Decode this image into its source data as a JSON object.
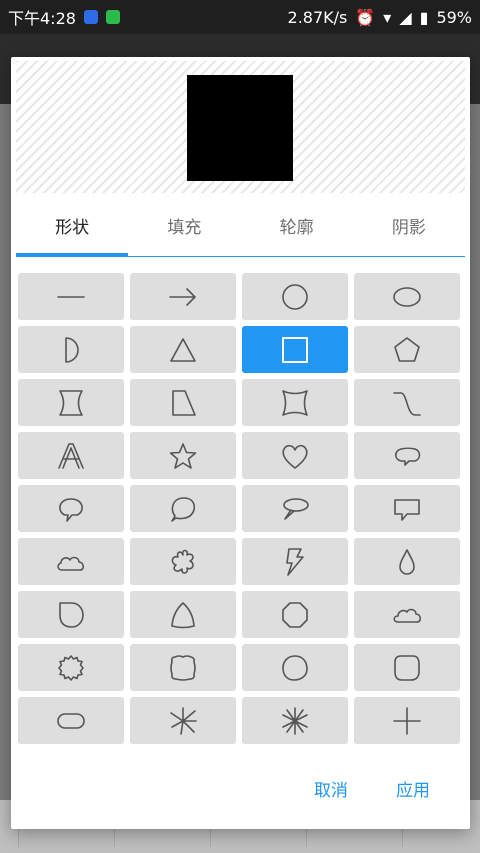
{
  "status_bar": {
    "time": "下午4:28",
    "speed": "2.87K/s",
    "battery": "59%"
  },
  "tabs": [
    {
      "label": "形状",
      "active": true
    },
    {
      "label": "填充",
      "active": false
    },
    {
      "label": "轮廓",
      "active": false
    },
    {
      "label": "阴影",
      "active": false
    }
  ],
  "shapes": [
    {
      "name": "line",
      "selected": false
    },
    {
      "name": "arrow",
      "selected": false
    },
    {
      "name": "circle",
      "selected": false
    },
    {
      "name": "ellipse",
      "selected": false
    },
    {
      "name": "half-circle",
      "selected": false
    },
    {
      "name": "triangle",
      "selected": false
    },
    {
      "name": "square",
      "selected": true
    },
    {
      "name": "pentagon",
      "selected": false
    },
    {
      "name": "hourglass",
      "selected": false
    },
    {
      "name": "trapezoid",
      "selected": false
    },
    {
      "name": "concave-square",
      "selected": false
    },
    {
      "name": "s-curve",
      "selected": false
    },
    {
      "name": "letter-a",
      "selected": false
    },
    {
      "name": "star",
      "selected": false
    },
    {
      "name": "heart",
      "selected": false
    },
    {
      "name": "speech-oval",
      "selected": false
    },
    {
      "name": "speech-bubble",
      "selected": false
    },
    {
      "name": "round-bubble",
      "selected": false
    },
    {
      "name": "thought-bubble",
      "selected": false
    },
    {
      "name": "rect-callout",
      "selected": false
    },
    {
      "name": "cloud",
      "selected": false
    },
    {
      "name": "flower",
      "selected": false
    },
    {
      "name": "lightning",
      "selected": false
    },
    {
      "name": "drop",
      "selected": false
    },
    {
      "name": "d-shape",
      "selected": false
    },
    {
      "name": "reuleaux-triangle",
      "selected": false
    },
    {
      "name": "octagon",
      "selected": false
    },
    {
      "name": "cloud-small",
      "selected": false
    },
    {
      "name": "seal",
      "selected": false
    },
    {
      "name": "scalloped-square",
      "selected": false
    },
    {
      "name": "blob-circle",
      "selected": false
    },
    {
      "name": "rounded-square",
      "selected": false
    },
    {
      "name": "pill",
      "selected": false
    },
    {
      "name": "burst",
      "selected": false
    },
    {
      "name": "asterisk",
      "selected": false
    },
    {
      "name": "cross",
      "selected": false
    }
  ],
  "actions": {
    "cancel": "取消",
    "apply": "应用"
  },
  "colors": {
    "accent": "#2196f3",
    "preview_shape": "#000000"
  }
}
